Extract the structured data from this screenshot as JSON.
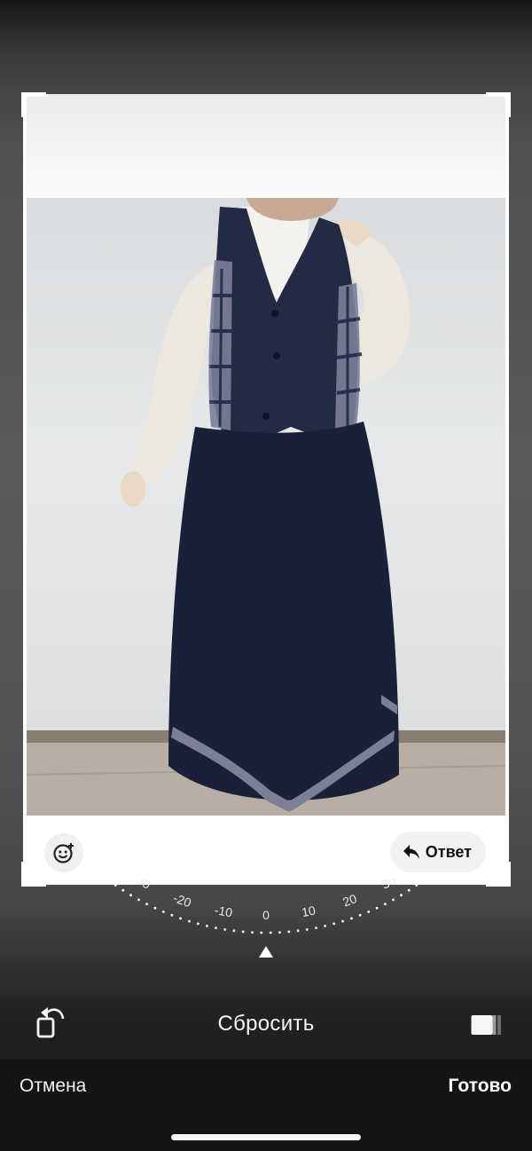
{
  "editor": {
    "dial": {
      "tick_labels": [
        "30",
        "-20",
        "-10",
        "0",
        "10",
        "20",
        "30"
      ],
      "current_angle": 0
    },
    "rotate_icon": "rotate-left-icon",
    "reset_label": "Сбросить",
    "aspect_icon": "aspect-ratio-icon",
    "cancel_label": "Отмена",
    "done_label": "Готово"
  },
  "preview": {
    "emoji_icon": "add-reaction-icon",
    "reply_icon": "reply-arrow-icon",
    "reply_label": "Ответ",
    "photo_description_icon": "photo-image"
  }
}
